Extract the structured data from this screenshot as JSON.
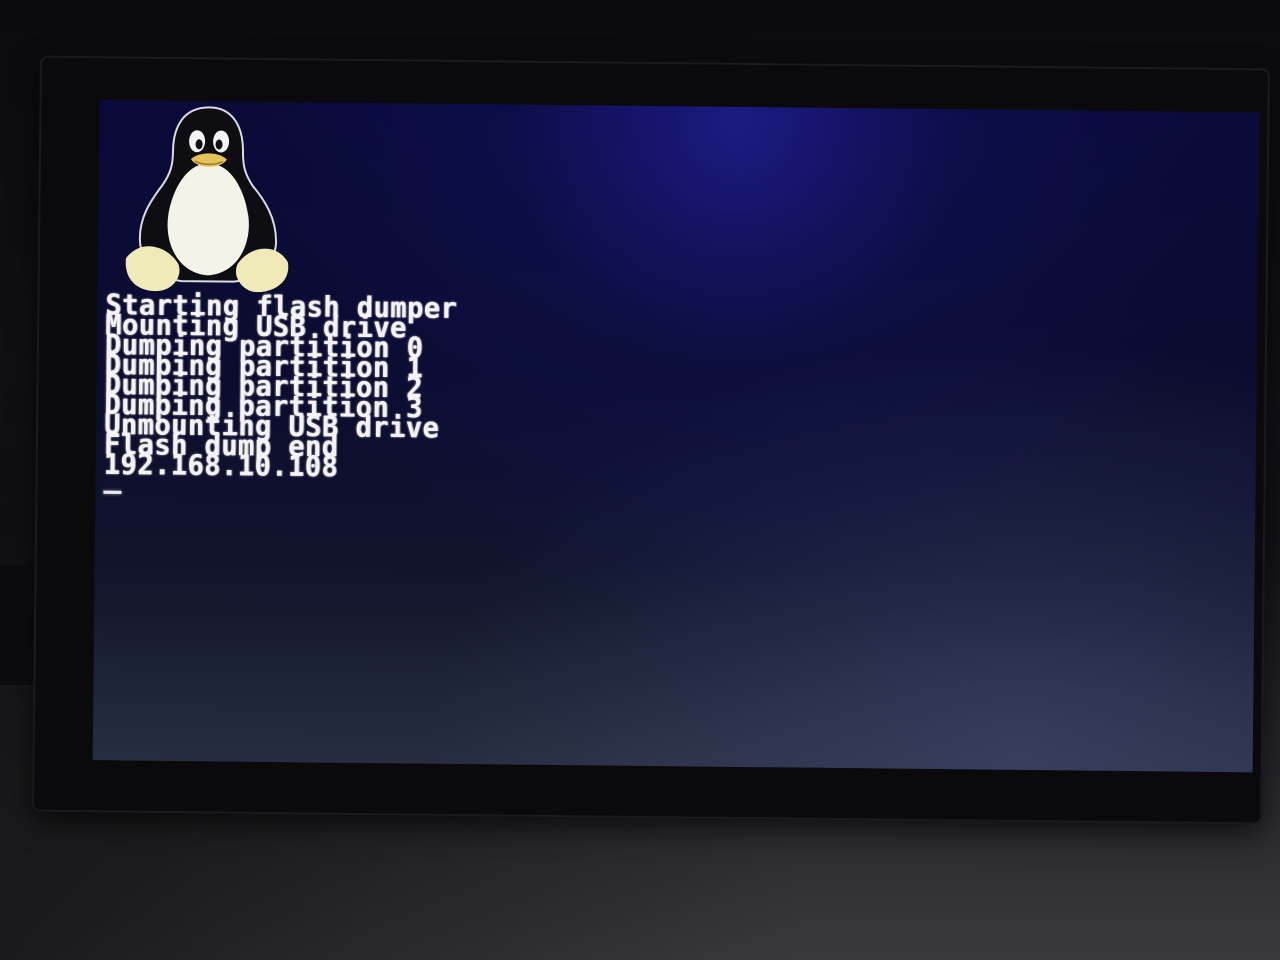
{
  "screen": {
    "background_color": "#0b0c2e",
    "text_color": "#f3f3f6",
    "logo_icon": "tux-penguin-icon",
    "console_lines": [
      "Starting flash dumper",
      "Mounting USB drive",
      "Dumping partition 0",
      "Dumping partition 1",
      "Dumping partition 2",
      "Dumping partition 3",
      "Unmounting USB drive",
      "Flash dump end",
      "192.168.10.108"
    ]
  }
}
